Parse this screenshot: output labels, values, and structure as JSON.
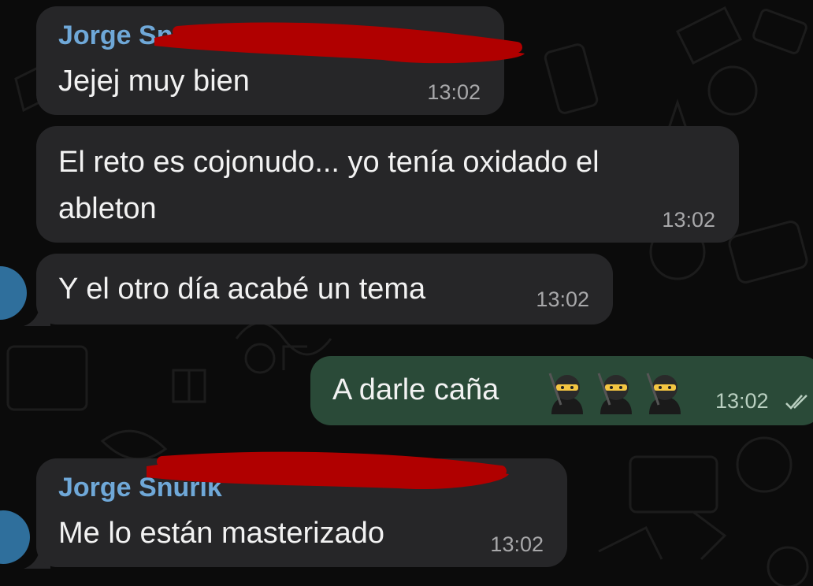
{
  "messages": [
    {
      "type": "incoming",
      "sender": "Jorge Snurik",
      "text": "Jejej muy bien",
      "time": "13:02"
    },
    {
      "type": "incoming",
      "text_line1": "El reto es cojonudo... yo tenía oxidado el",
      "text_line2": "ableton",
      "time": "13:02"
    },
    {
      "type": "incoming",
      "text": "Y el otro día acabé un tema",
      "time": "13:02"
    },
    {
      "type": "outgoing",
      "text": "A darle caña",
      "emoji": [
        "ninja",
        "ninja",
        "ninja"
      ],
      "time": "13:02",
      "status": "read"
    },
    {
      "type": "incoming",
      "sender": "Jorge Snurik",
      "text": "Me lo están masterizado",
      "time": "13:02"
    }
  ],
  "colors": {
    "background": "#0b0b0b",
    "incoming_bubble": "#262628",
    "outgoing_bubble": "#2a4a38",
    "sender_name": "#6fa8d8",
    "redaction": "#b00000"
  }
}
